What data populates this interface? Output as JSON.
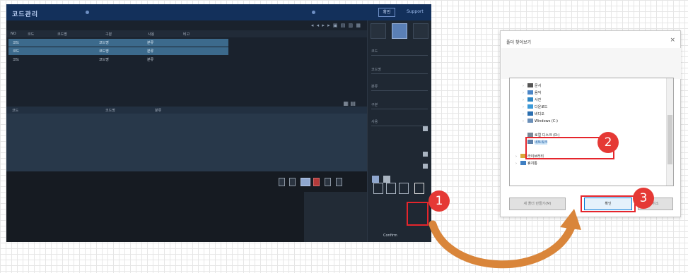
{
  "app": {
    "logo": "코드관리",
    "titlebar_button": "확인",
    "titlebar_link": "Support",
    "grid_columns": [
      "NO",
      "코드",
      "코드명",
      "구분",
      "사용",
      "비고"
    ],
    "grid_rows": [
      [
        "코드",
        "코드명",
        "분류"
      ],
      [
        "코드",
        "코드명",
        "분류"
      ],
      [
        "코드",
        "코드명",
        "분류"
      ]
    ],
    "mid_columns": [
      "코드",
      "코드명",
      "분류"
    ],
    "right_panel": {
      "fields": [
        "코드",
        "코드명",
        "분류",
        "구분",
        "사용"
      ],
      "btn_label": "Confirm"
    },
    "info_lines": [
      "",
      "",
      "",
      "",
      ""
    ]
  },
  "dialog": {
    "title": "폴더 찾아보기",
    "tree": [
      {
        "label": "문서"
      },
      {
        "label": "음악"
      },
      {
        "label": "사진"
      },
      {
        "label": "다운로드"
      },
      {
        "label": "비디오"
      },
      {
        "label": "Windows (C:)"
      },
      {
        "label": "로컬 디스크 (D:)",
        "selected": true
      },
      {
        "label": "네트워크"
      },
      {
        "label": "라이브러리"
      },
      {
        "label": "휴지통"
      }
    ],
    "new_folder_button": "새 폴더 만들기(M)",
    "ok_button": "확인",
    "cancel_button": "취소"
  },
  "callouts": [
    "1",
    "2",
    "3"
  ],
  "colors": {
    "callout": "#e53935",
    "highlight_box": "#e5252c",
    "arrow": "#d9853a"
  }
}
